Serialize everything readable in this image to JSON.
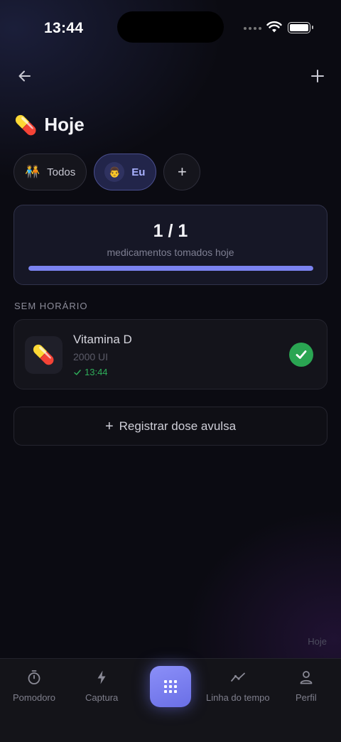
{
  "status_bar": {
    "time": "13:44"
  },
  "header": {
    "title": "Hoje",
    "title_emoji": "💊",
    "back_icon": "arrow-left-icon",
    "add_icon": "plus-icon"
  },
  "filters": [
    {
      "label": "Todos",
      "emoji": "🧑‍🤝‍🧑",
      "active": false
    },
    {
      "label": "Eu",
      "emoji": "👨",
      "active": true
    },
    {
      "label": "+",
      "active": false
    }
  ],
  "progress": {
    "value_text": "1 / 1",
    "label": "medicamentos tomados hoje",
    "fraction": 1.0
  },
  "section": {
    "label": "SEM HORÁRIO"
  },
  "medication": {
    "emoji": "💊",
    "name": "Vitamina D",
    "dose": "2000 UI",
    "taken_time": "13:44",
    "taken": true
  },
  "dose_button": {
    "label": "Registrar dose avulsa"
  },
  "corner_label": "Hoje",
  "tabbar": {
    "tabs": [
      {
        "label": "Pomodoro",
        "icon": "stopwatch-icon"
      },
      {
        "label": "Captura",
        "icon": "lightning-icon"
      },
      {
        "label": "Linha do tempo",
        "icon": "timeline-icon"
      },
      {
        "label": "Perfil",
        "icon": "person-icon"
      }
    ],
    "center_icon": "grid-icon"
  },
  "colors": {
    "accent": "#7b83f0",
    "success": "#2aa552",
    "background": "#0b0b12"
  }
}
